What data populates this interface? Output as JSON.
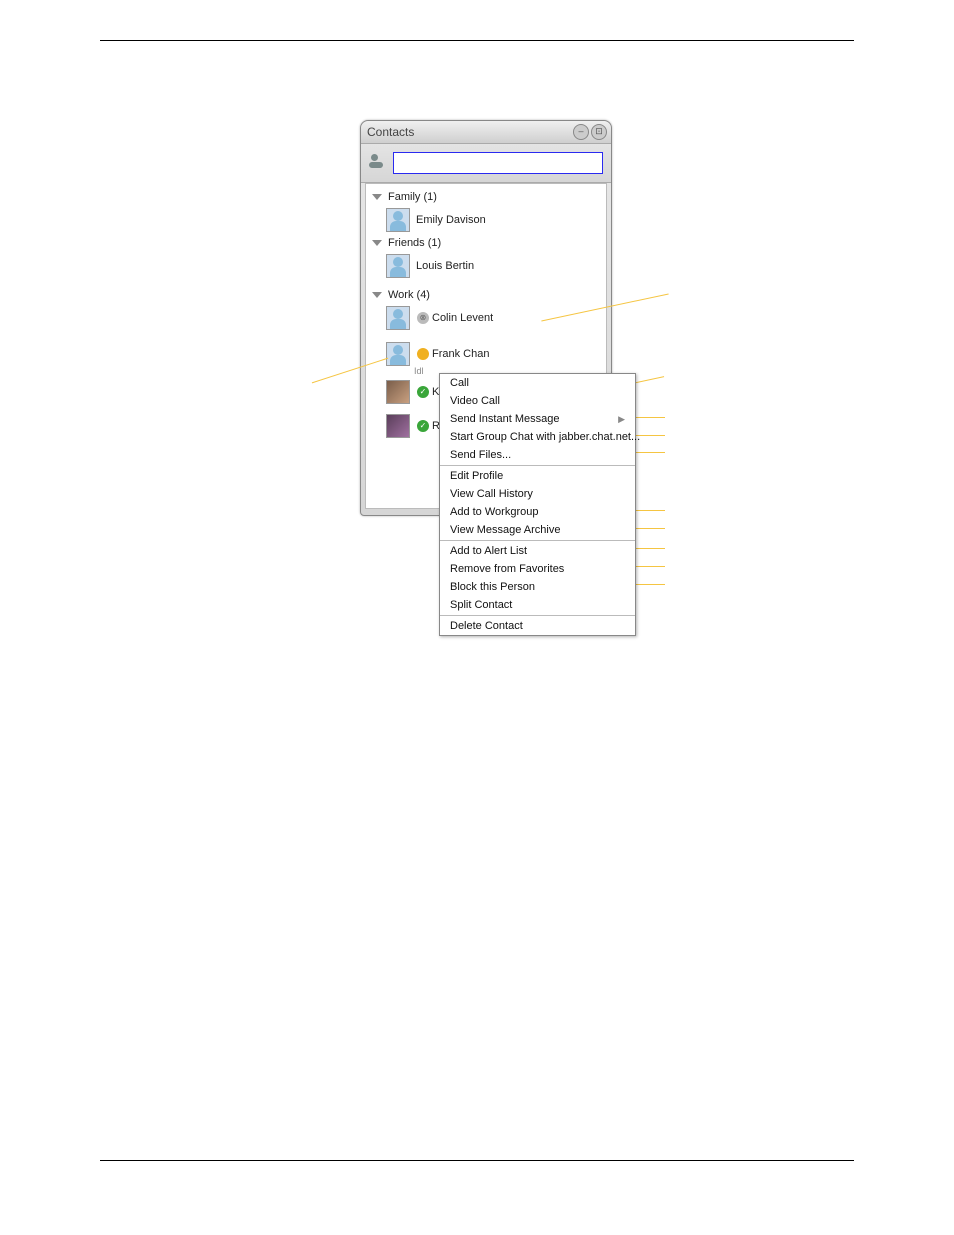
{
  "window": {
    "title": "Contacts"
  },
  "search": {
    "value": ""
  },
  "groups": [
    {
      "name": "Family",
      "count": "(1)",
      "contacts": [
        {
          "name": "Emily Davison",
          "avatar": "default",
          "status": "none"
        }
      ]
    },
    {
      "name": "Friends",
      "count": "(1)",
      "contacts": [
        {
          "name": "Louis Bertin",
          "avatar": "default",
          "status": "none"
        }
      ]
    },
    {
      "name": "Work",
      "count": "(4)",
      "contacts": [
        {
          "name": "Colin Levent",
          "avatar": "default",
          "status": "offline",
          "badge": "⊗"
        },
        {
          "name": "Frank Chan",
          "avatar": "default",
          "status": "idle",
          "sub": "Idl"
        },
        {
          "name": "Kc",
          "avatar": "photo1",
          "status": "online",
          "badge": "✓"
        },
        {
          "name": "R",
          "avatar": "photo2",
          "status": "online",
          "badge": "✓"
        }
      ]
    }
  ],
  "menu": {
    "items": [
      {
        "label": "Call"
      },
      {
        "label": "Video Call"
      },
      {
        "label": "Send Instant Message",
        "submenu": true
      },
      {
        "label": "Start Group Chat with jabber.chat.net..."
      },
      {
        "label": "Send Files..."
      },
      {
        "sep": true
      },
      {
        "label": "Edit Profile"
      },
      {
        "label": "View Call History"
      },
      {
        "label": "Add to Workgroup"
      },
      {
        "label": "View Message Archive"
      },
      {
        "sep": true
      },
      {
        "label": "Add to Alert List"
      },
      {
        "label": "Remove from Favorites"
      },
      {
        "label": "Block this Person"
      },
      {
        "label": "Split Contact"
      },
      {
        "sep": true
      },
      {
        "label": "Delete Contact"
      }
    ]
  }
}
